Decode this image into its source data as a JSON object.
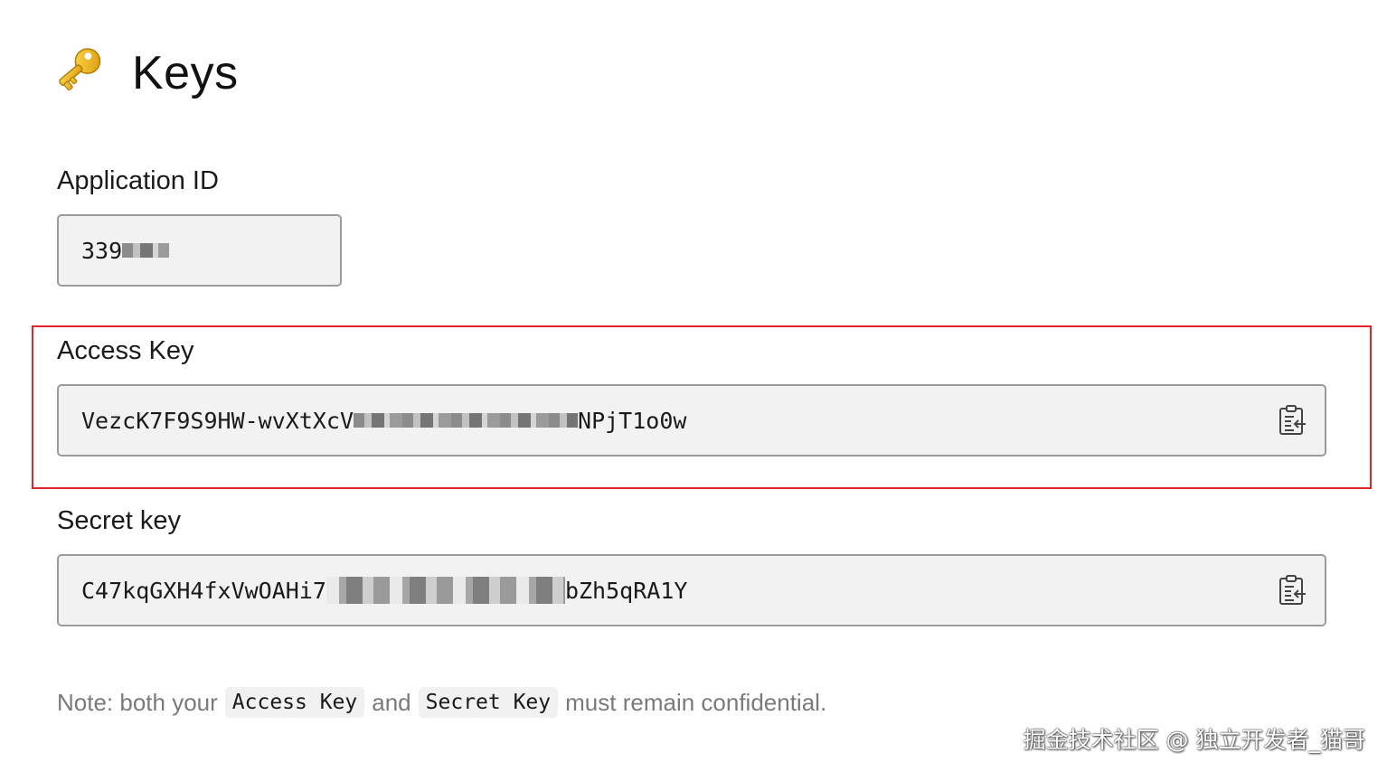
{
  "page": {
    "title": "Keys",
    "title_icon": "key-icon"
  },
  "application_id": {
    "label": "Application ID",
    "value_visible": "339"
  },
  "access_key": {
    "label": "Access Key",
    "value_prefix": "VezcK7F9S9HW-wvXtXcV",
    "value_suffix": "NPjT1o0w",
    "copy_icon": "clipboard-copy-icon",
    "highlighted": true
  },
  "secret_key": {
    "label": "Secret key",
    "value_prefix": "C47kqGXH4fxVwOAHi7",
    "value_suffix": "bZh5qRA1Y",
    "copy_icon": "clipboard-copy-icon"
  },
  "note": {
    "prefix": "Note: both your",
    "code_1": "Access Key",
    "middle": "and",
    "code_2": "Secret Key",
    "suffix": "must remain confidential."
  },
  "watermark": "掘金技术社区 @ 独立开发者_猫哥",
  "colors": {
    "highlight_border": "#e0262b",
    "field_background": "#f2f2f2",
    "field_border": "#9b9b9b",
    "note_text": "#7a7a7a"
  }
}
